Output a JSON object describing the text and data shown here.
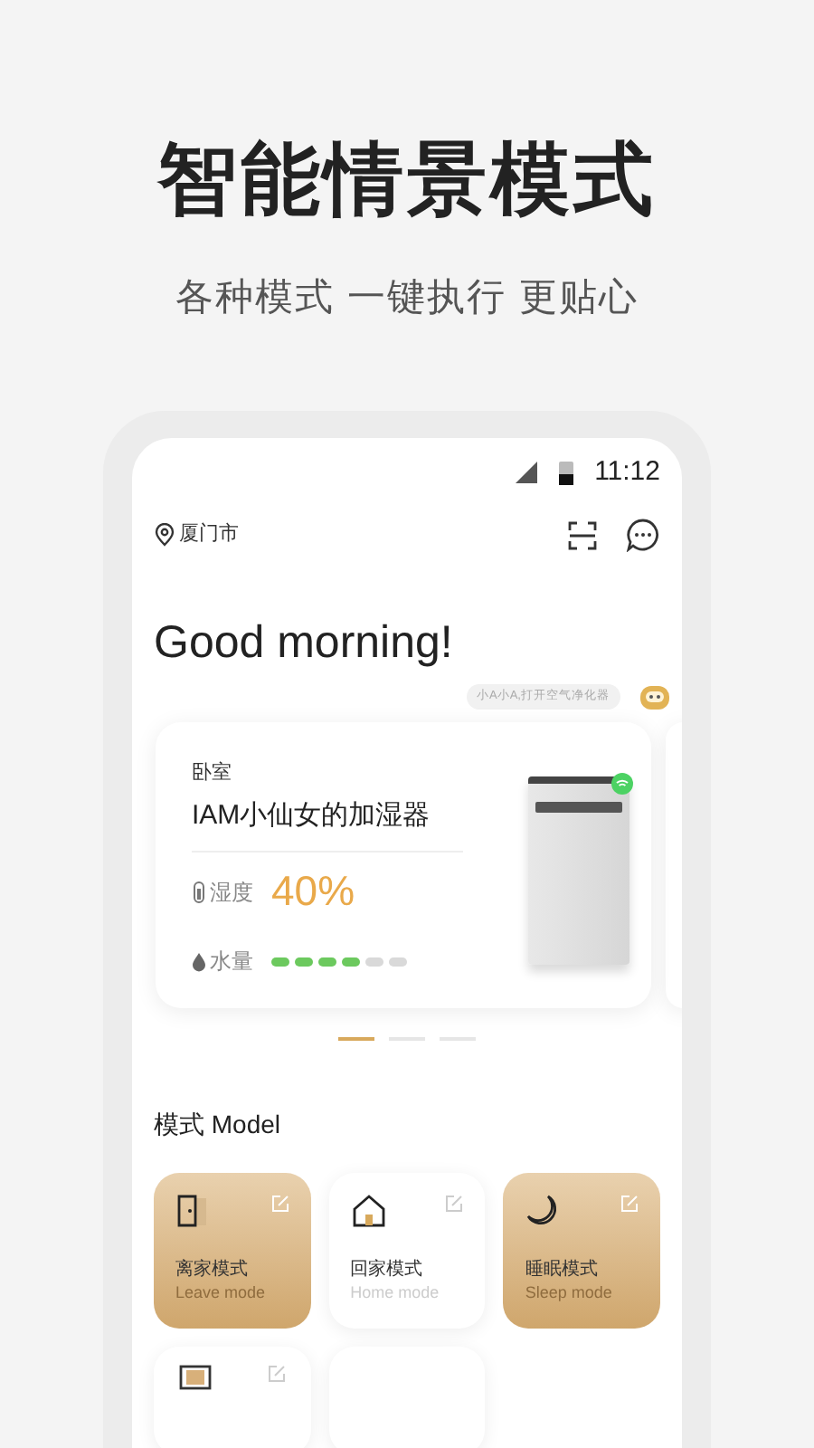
{
  "headline": "智能情景模式",
  "subtitle": "各种模式 一键执行 更贴心",
  "status_bar": {
    "time": "11:12"
  },
  "location": "厦门市",
  "greeting": "Good morning!",
  "assistant_bubble": "小A小A,打开空气净化器",
  "device_card": {
    "room": "卧室",
    "name": "IAM小仙女的加湿器",
    "humidity_label": "湿度",
    "humidity_value": "40%",
    "water_label": "水量",
    "water": {
      "level": 0.67
    },
    "online": true
  },
  "carousel_dots": [
    {
      "selected": true
    },
    {
      "selected": false
    },
    {
      "selected": false
    }
  ],
  "modes_title": "模式 Model",
  "modes": [
    {
      "kind": "leave",
      "title": "离家模式",
      "subtitle": "Leave mode",
      "selected": true
    },
    {
      "kind": "home",
      "title": "回家模式",
      "subtitle": "Home mode",
      "selected": false
    },
    {
      "kind": "sleep",
      "title": "睡眠模式",
      "subtitle": "Sleep mode",
      "selected": true
    }
  ]
}
